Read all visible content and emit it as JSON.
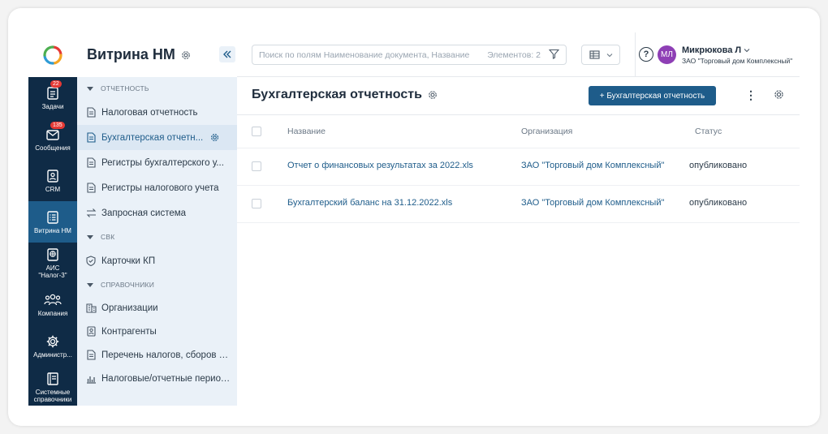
{
  "rail": {
    "items": [
      {
        "label": "Задачи",
        "badge": "22",
        "icon": "tasks-icon"
      },
      {
        "label": "Сообщения",
        "badge": "135",
        "icon": "mail-icon"
      },
      {
        "label": "CRM",
        "icon": "crm-icon"
      },
      {
        "label": "Витрина НМ",
        "icon": "showcase-icon",
        "active": true
      },
      {
        "label": "АИС \"Налог-3\"",
        "icon": "globe-icon"
      },
      {
        "label": "Компания",
        "icon": "people-icon"
      },
      {
        "label": "Администр...",
        "icon": "gear-icon"
      },
      {
        "label": "Системные справочники",
        "icon": "book-icon"
      }
    ]
  },
  "sidebar": {
    "title": "Витрина НМ",
    "sections": [
      {
        "title": "ОТЧЕТНОСТЬ",
        "items": [
          {
            "label": "Налоговая отчетность"
          },
          {
            "label": "Бухгалтерская отчетн...",
            "active": true
          },
          {
            "label": "Регистры бухгалтерского у..."
          },
          {
            "label": "Регистры налогового учета"
          },
          {
            "label": "Запросная система"
          }
        ]
      },
      {
        "title": "СВК",
        "items": [
          {
            "label": "Карточки КП"
          }
        ]
      },
      {
        "title": "СПРАВОЧНИКИ",
        "items": [
          {
            "label": "Организации"
          },
          {
            "label": "Контрагенты"
          },
          {
            "label": "Перечень налогов, сборов и с..."
          },
          {
            "label": "Налоговые/отчетные периоды"
          }
        ]
      }
    ]
  },
  "topbar": {
    "search_placeholder": "Поиск по полям Наименование документа, Название",
    "count_text": "Элементов: 2",
    "help": "?",
    "user_initials": "МЛ",
    "user_name": "Микрюкова Л",
    "user_org": "ЗАО \"Торговый дом Комплексный\""
  },
  "page": {
    "title": "Бухгалтерская отчетность",
    "add_button": "+ Бухгалтерская отчетность",
    "more": "⋮"
  },
  "table": {
    "columns": [
      "Название",
      "Организация",
      "Статус"
    ],
    "rows": [
      {
        "name": "Отчет о финансовых результатах за 2022.xls",
        "org": "ЗАО \"Торговый дом Комплексный\"",
        "status": "опубликовано"
      },
      {
        "name": "Бухгалтерский баланс на 31.12.2022.xls",
        "org": "ЗАО \"Торговый дом Комплексный\"",
        "status": "опубликовано"
      }
    ]
  },
  "colors": {
    "rail": "#0f2b46",
    "rail_active": "#1e5c8a",
    "accent": "#1e5c8a",
    "avatar": "#8e3fb5",
    "badge": "#e53935"
  }
}
